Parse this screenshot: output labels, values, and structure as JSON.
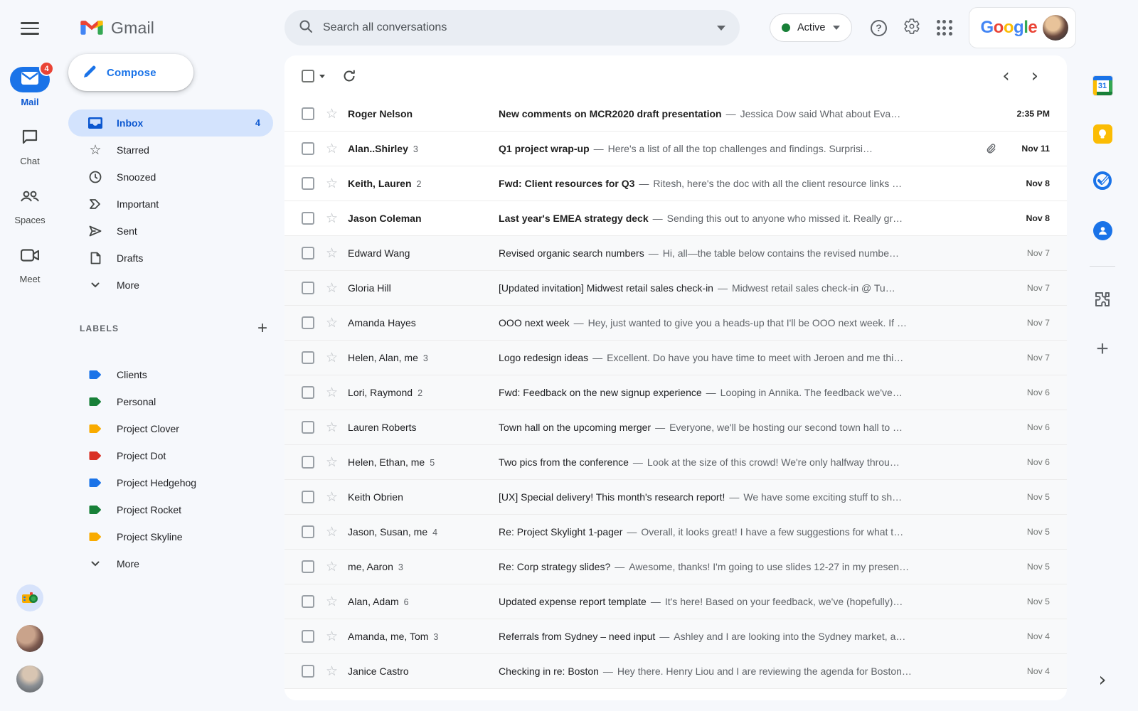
{
  "header": {
    "search": {
      "placeholder": "Search all conversations"
    },
    "status": {
      "label": "Active",
      "dot_color": "#188038"
    },
    "google_letters": [
      {
        "ch": "G",
        "color": "#4285F4"
      },
      {
        "ch": "o",
        "color": "#EA4335"
      },
      {
        "ch": "o",
        "color": "#FBBC04"
      },
      {
        "ch": "g",
        "color": "#4285F4"
      },
      {
        "ch": "l",
        "color": "#34A853"
      },
      {
        "ch": "e",
        "color": "#EA4335"
      }
    ]
  },
  "left_rail": {
    "items": [
      {
        "label": "Mail",
        "badge": "4",
        "active": true
      },
      {
        "label": "Chat",
        "active": false
      },
      {
        "label": "Spaces",
        "active": false
      },
      {
        "label": "Meet",
        "active": false
      }
    ]
  },
  "drawer": {
    "logo_text": "Gmail",
    "compose_label": "Compose",
    "nav": [
      {
        "label": "Inbox",
        "count": "4",
        "active": true
      },
      {
        "label": "Starred"
      },
      {
        "label": "Snoozed"
      },
      {
        "label": "Important"
      },
      {
        "label": "Sent"
      },
      {
        "label": "Drafts"
      },
      {
        "label": "More"
      }
    ],
    "labels_header": "LABELS",
    "labels": [
      {
        "label": "Clients",
        "color": "#1a73e8"
      },
      {
        "label": "Personal",
        "color": "#188038"
      },
      {
        "label": "Project Clover",
        "color": "#f9ab00"
      },
      {
        "label": "Project Dot",
        "color": "#d93025"
      },
      {
        "label": "Project Hedgehog",
        "color": "#1a73e8"
      },
      {
        "label": "Project Rocket",
        "color": "#188038"
      },
      {
        "label": "Project Skyline",
        "color": "#f9ab00"
      }
    ],
    "labels_more": "More"
  },
  "list": {
    "separator": "—",
    "emails": [
      {
        "sender": "Roger Nelson",
        "count": "",
        "subject": "New comments on MCR2020 draft presentation",
        "snippet": "Jessica Dow said What about Eva…",
        "date": "2:35 PM",
        "unread": true,
        "attachment": false
      },
      {
        "sender": "Alan..Shirley",
        "count": "3",
        "subject": "Q1 project wrap-up",
        "snippet": "Here's a list of all the top challenges and findings. Surprisi…",
        "date": "Nov 11",
        "unread": true,
        "attachment": true
      },
      {
        "sender": "Keith, Lauren",
        "count": "2",
        "subject": "Fwd: Client resources for Q3",
        "snippet": "Ritesh, here's the doc with all the client resource links …",
        "date": "Nov 8",
        "unread": true,
        "attachment": false
      },
      {
        "sender": "Jason Coleman",
        "count": "",
        "subject": "Last year's EMEA strategy deck",
        "snippet": "Sending this out to anyone who missed it. Really gr…",
        "date": "Nov 8",
        "unread": true,
        "attachment": false
      },
      {
        "sender": "Edward Wang",
        "count": "",
        "subject": "Revised organic search numbers",
        "snippet": "Hi, all—the table below contains the revised numbe…",
        "date": "Nov 7",
        "unread": false,
        "attachment": false
      },
      {
        "sender": "Gloria Hill",
        "count": "",
        "subject": "[Updated invitation] Midwest retail sales check-in",
        "snippet": "Midwest retail sales check-in @ Tu…",
        "date": "Nov 7",
        "unread": false,
        "attachment": false
      },
      {
        "sender": "Amanda Hayes",
        "count": "",
        "subject": "OOO next week",
        "snippet": "Hey, just wanted to give you a heads-up that I'll be OOO next week. If …",
        "date": "Nov 7",
        "unread": false,
        "attachment": false
      },
      {
        "sender": "Helen, Alan, me",
        "count": "3",
        "subject": "Logo redesign ideas",
        "snippet": "Excellent. Do have you have time to meet with Jeroen and me thi…",
        "date": "Nov 7",
        "unread": false,
        "attachment": false
      },
      {
        "sender": "Lori, Raymond",
        "count": "2",
        "subject": "Fwd: Feedback on the new signup experience",
        "snippet": "Looping in Annika. The feedback we've…",
        "date": "Nov 6",
        "unread": false,
        "attachment": false
      },
      {
        "sender": "Lauren Roberts",
        "count": "",
        "subject": "Town hall on the upcoming merger",
        "snippet": "Everyone, we'll be hosting our second town hall to …",
        "date": "Nov 6",
        "unread": false,
        "attachment": false
      },
      {
        "sender": "Helen, Ethan, me",
        "count": "5",
        "subject": "Two pics from the conference",
        "snippet": "Look at the size of this crowd! We're only halfway throu…",
        "date": "Nov 6",
        "unread": false,
        "attachment": false
      },
      {
        "sender": "Keith Obrien",
        "count": "",
        "subject": "[UX] Special delivery! This month's research report!",
        "snippet": "We have some exciting stuff to sh…",
        "date": "Nov 5",
        "unread": false,
        "attachment": false
      },
      {
        "sender": "Jason, Susan, me",
        "count": "4",
        "subject": "Re: Project Skylight 1-pager",
        "snippet": "Overall, it looks great! I have a few suggestions for what t…",
        "date": "Nov 5",
        "unread": false,
        "attachment": false
      },
      {
        "sender": "me, Aaron",
        "count": "3",
        "subject": "Re: Corp strategy slides?",
        "snippet": "Awesome, thanks! I'm going to use slides 12-27 in my presen…",
        "date": "Nov 5",
        "unread": false,
        "attachment": false
      },
      {
        "sender": "Alan, Adam",
        "count": "6",
        "subject": "Updated expense report template",
        "snippet": "It's here! Based on your feedback, we've (hopefully)…",
        "date": "Nov 5",
        "unread": false,
        "attachment": false
      },
      {
        "sender": "Amanda, me, Tom",
        "count": "3",
        "subject": "Referrals from Sydney – need input",
        "snippet": "Ashley and I are looking into the Sydney market, a…",
        "date": "Nov 4",
        "unread": false,
        "attachment": false
      },
      {
        "sender": "Janice Castro",
        "count": "",
        "subject": "Checking in re: Boston",
        "snippet": "Hey there. Henry Liou and I are reviewing the agenda for Boston…",
        "date": "Nov 4",
        "unread": false,
        "attachment": false
      }
    ]
  },
  "side_rail": {
    "calendar_text": "31"
  }
}
